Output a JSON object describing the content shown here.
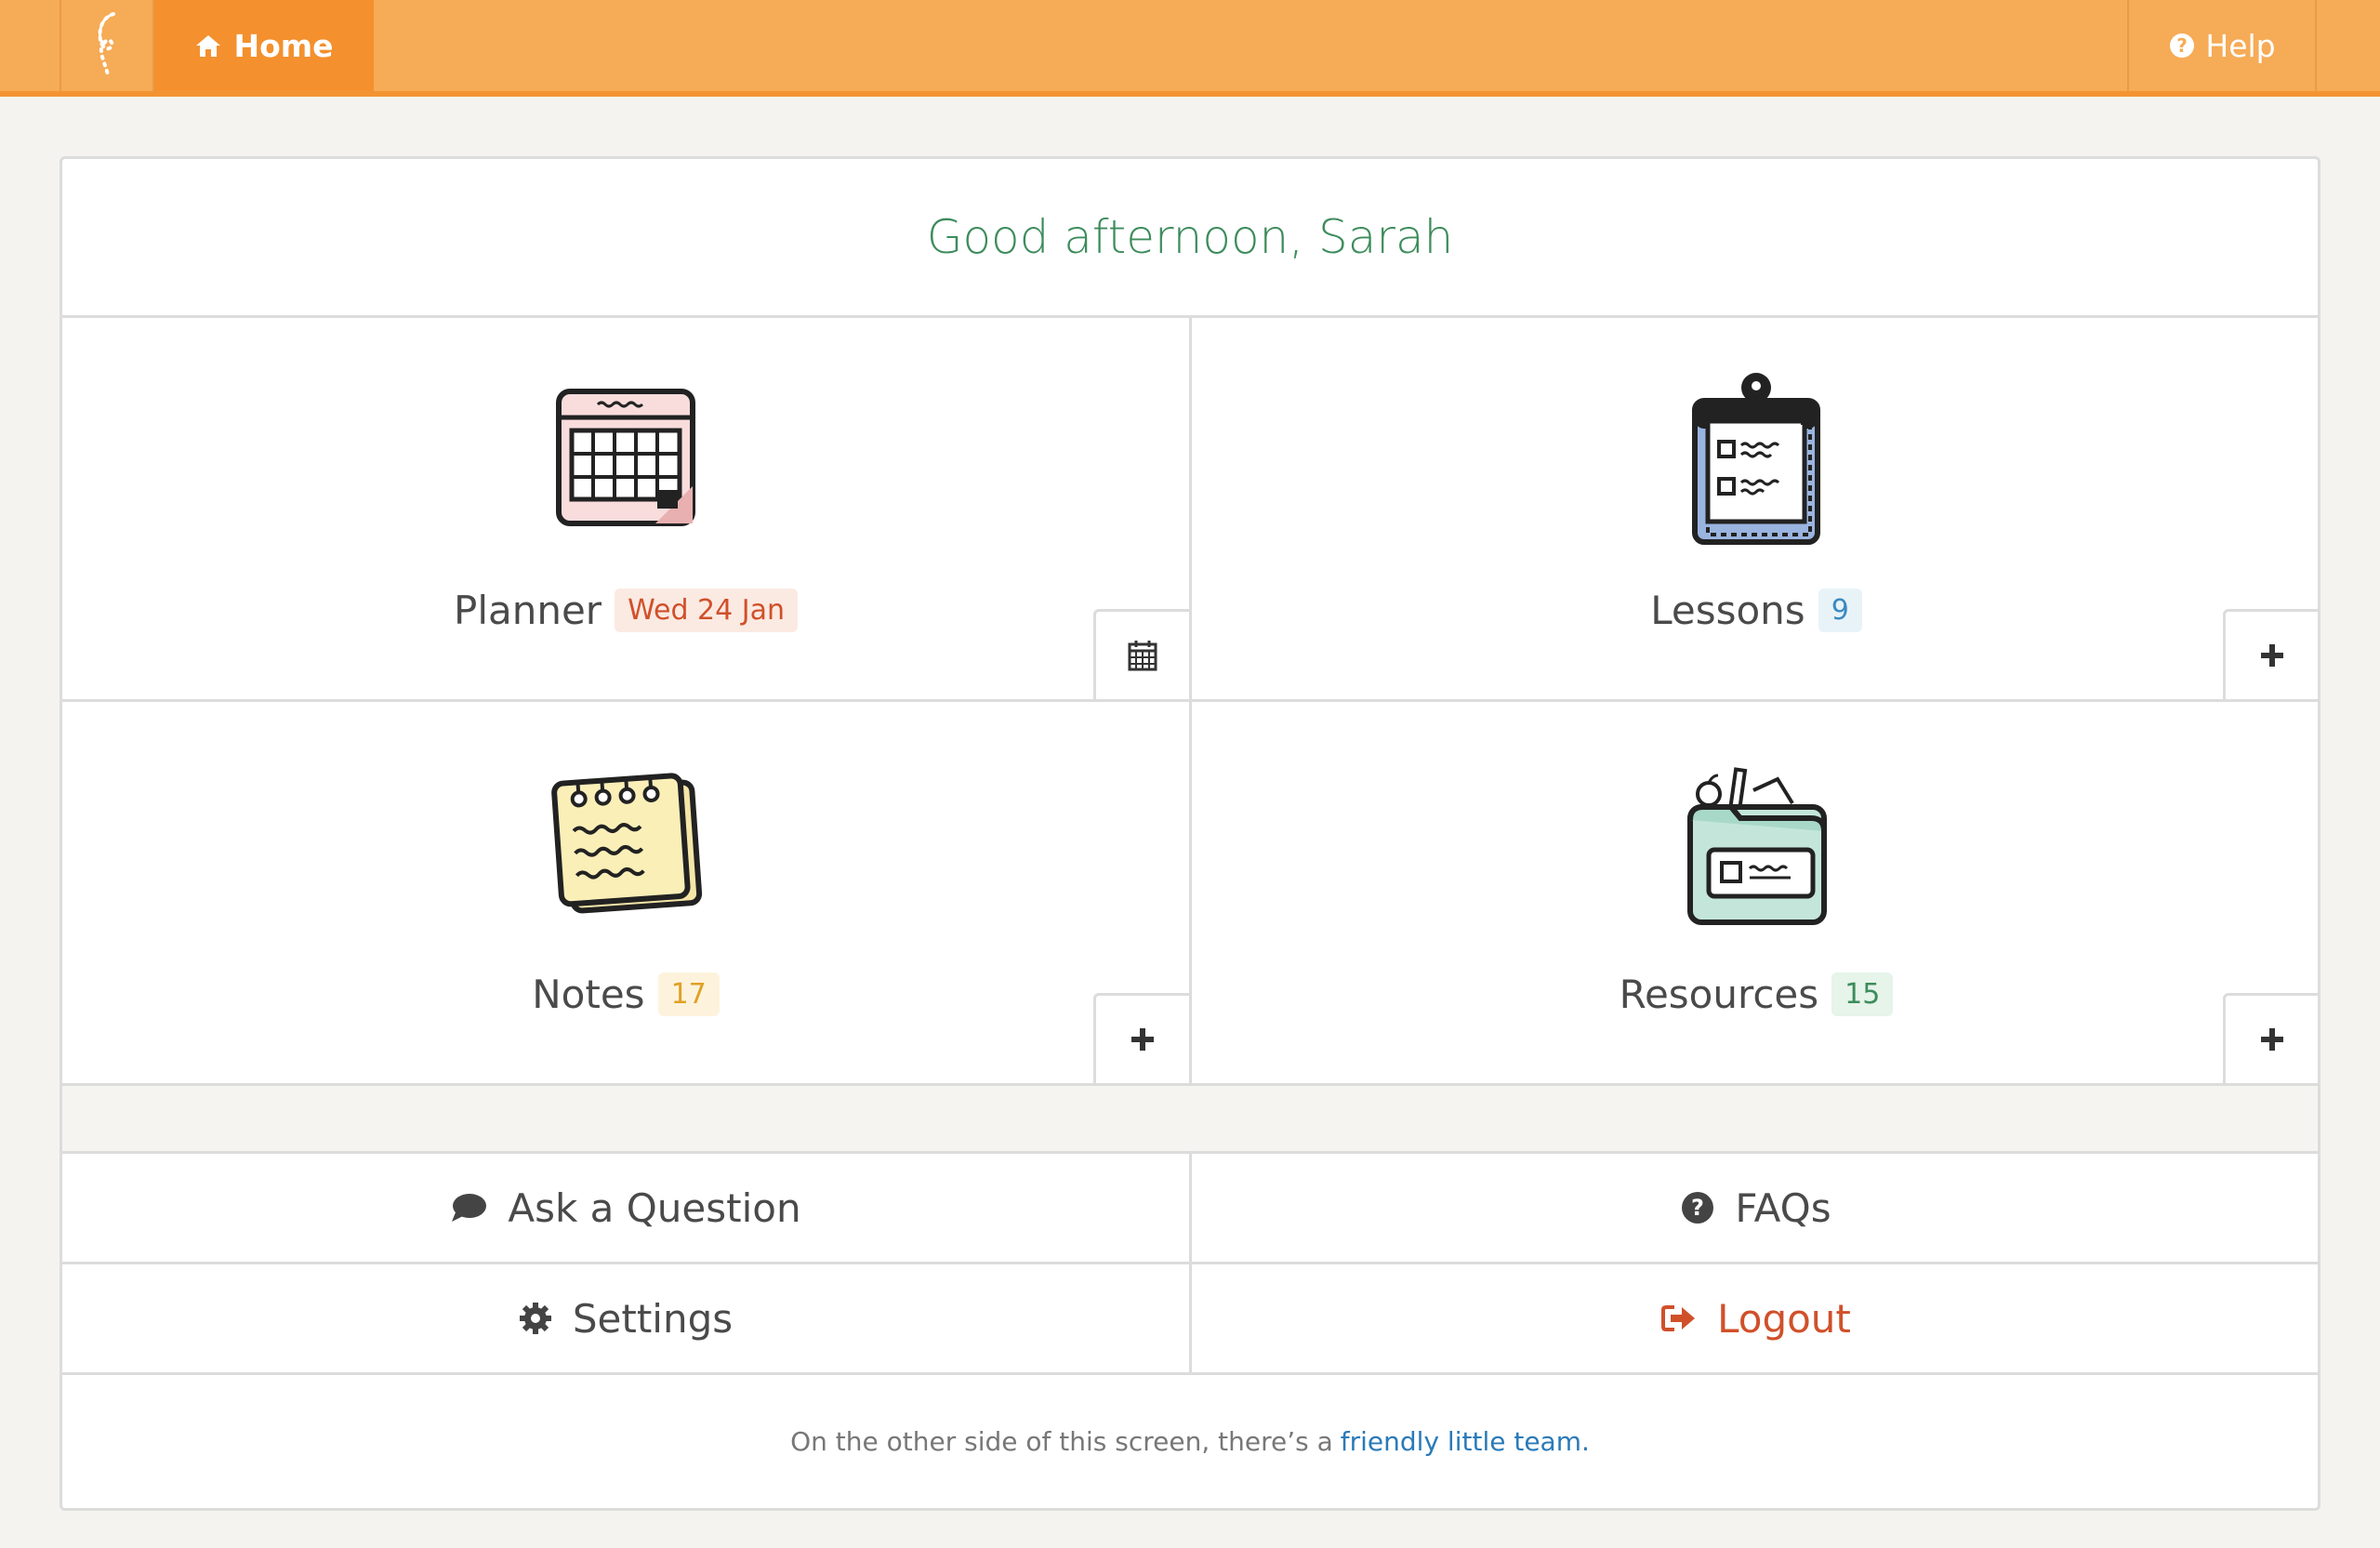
{
  "nav": {
    "logo_icon": "seahorse-logo-icon",
    "home_label": "Home",
    "home_icon": "home-icon",
    "help_label": "Help",
    "help_icon": "question-circle-icon"
  },
  "greeting": "Good afternoon, Sarah",
  "tiles": {
    "planner": {
      "label": "Planner",
      "badge": "Wed 24 Jan",
      "icon": "calendar-illustration-icon",
      "action_icon": "calendar-icon"
    },
    "lessons": {
      "label": "Lessons",
      "badge": "9",
      "icon": "clipboard-illustration-icon",
      "action_icon": "plus-icon"
    },
    "notes": {
      "label": "Notes",
      "badge": "17",
      "icon": "notepad-illustration-icon",
      "action_icon": "plus-icon"
    },
    "resources": {
      "label": "Resources",
      "badge": "15",
      "icon": "folder-illustration-icon",
      "action_icon": "plus-icon"
    }
  },
  "links": {
    "ask": {
      "label": "Ask a Question",
      "icon": "speech-bubble-icon"
    },
    "faqs": {
      "label": "FAQs",
      "icon": "question-circle-icon"
    },
    "settings": {
      "label": "Settings",
      "icon": "gear-icon"
    },
    "logout": {
      "label": "Logout",
      "icon": "sign-out-icon"
    }
  },
  "footer": {
    "text": "On the other side of this screen, there’s a",
    "link": "friendly little team."
  },
  "colors": {
    "nav_bg": "#f6ab56",
    "nav_active": "#f4902d",
    "greeting": "#3d8c5c",
    "logout": "#d0502a",
    "link": "#2a7ab8"
  }
}
